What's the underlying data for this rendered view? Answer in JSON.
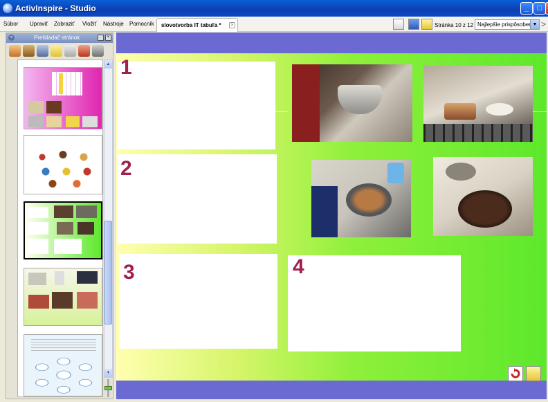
{
  "window": {
    "title": "ActivInspire - Studio"
  },
  "menu": {
    "items": [
      "Súbor",
      "Upraviť",
      "Zobraziť",
      "Vložiť",
      "Nástroje",
      "Pomocník"
    ]
  },
  "document_tab": {
    "label": "slovotvorba IT tabuľa *"
  },
  "toolbar": {
    "page_label": "Stránka 10 z 12",
    "zoom_value": "Najlepšie prispôsobenie"
  },
  "browser": {
    "title": "Prehliadač stránok"
  },
  "flipchart": {
    "numbers": [
      "1",
      "2",
      "3",
      "4"
    ],
    "colors": {
      "number": "#a02050",
      "background_start": "#ffffb0",
      "background_end": "#5de82c",
      "frame": "#6a6ad2"
    }
  },
  "icons": [
    "app-icon",
    "minimize-icon",
    "maximize-icon",
    "close-icon",
    "browser-tool-icons",
    "refresh-icon",
    "notes-icon"
  ]
}
